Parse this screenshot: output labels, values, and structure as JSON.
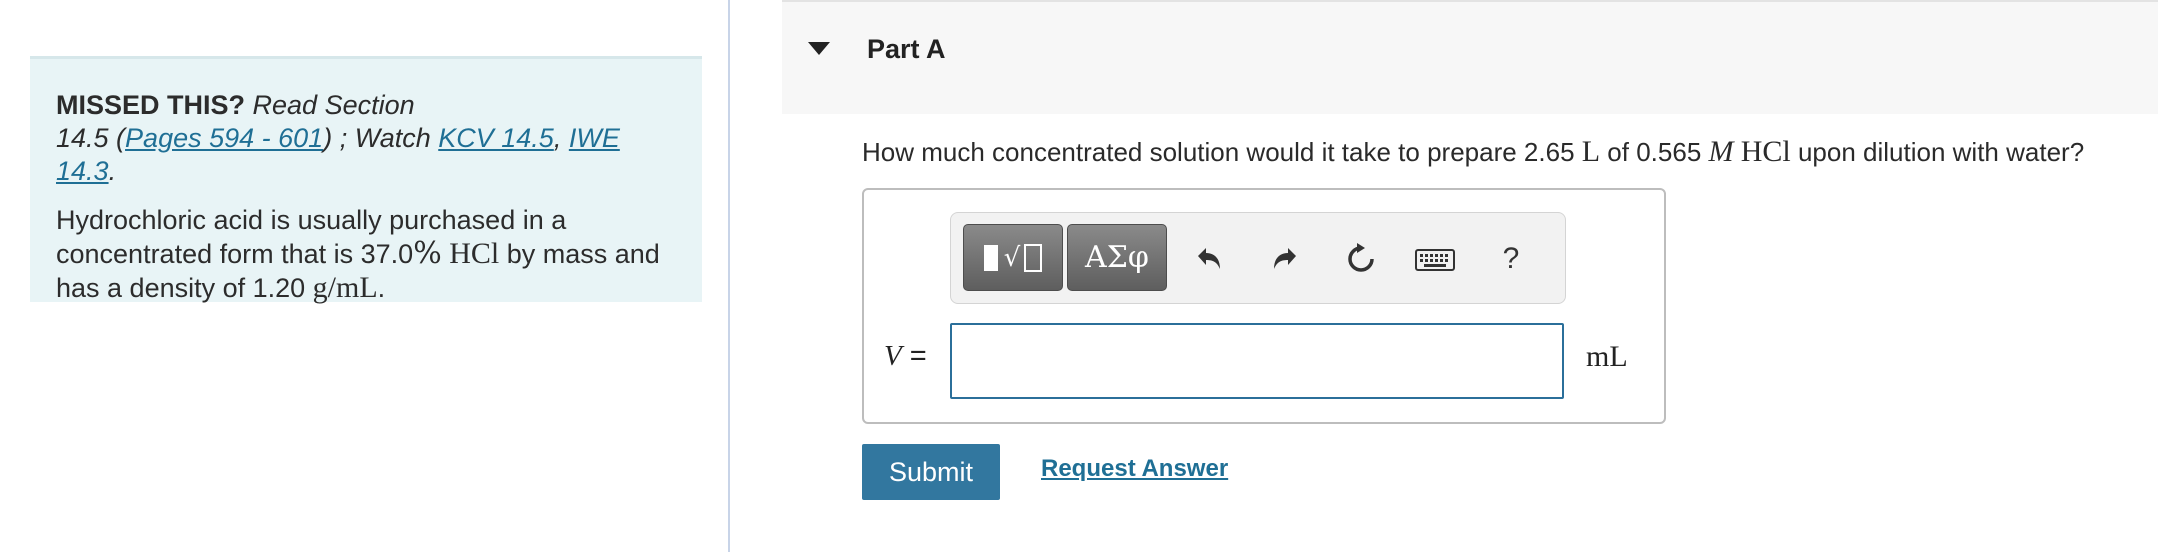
{
  "missed": {
    "title": "MISSED THIS?",
    "read_section": "Read Section",
    "section_number": "14.5 (",
    "pages_link": "Pages 594 - 601",
    "after_pages": ") ; Watch ",
    "kcv_link": "KCV 14.5",
    "comma": ", ",
    "iwe_link": "IWE 14.3",
    "period": ".",
    "para_text_1": "Hydrochloric acid is usually purchased in a concentrated form that is 37.0",
    "percent": "%",
    "hcl": "HCl",
    "para_text_2": " by mass and has a density of 1.20 ",
    "density_unit": "g/mL",
    "para_end": "."
  },
  "part": {
    "title": "Part A"
  },
  "question": {
    "text_1": "How much concentrated solution would it take to prepare 2.65 ",
    "unit_l": "L",
    "text_2": " of 0.565 ",
    "unit_m": "M",
    "species": "HCl",
    "text_3": " upon dilution with water?"
  },
  "answer": {
    "variable": "V",
    "equals": " =",
    "value": "",
    "unit": "mL"
  },
  "toolbar": {
    "templates_label": "√",
    "symbols_label": "ΑΣφ",
    "undo_icon": "undo-icon",
    "redo_icon": "redo-icon",
    "reset_icon": "reset-icon",
    "keyboard_icon": "keyboard-icon",
    "help_label": "?"
  },
  "actions": {
    "submit_label": "Submit",
    "request_answer_label": "Request Answer"
  },
  "colors": {
    "accent": "#32779f",
    "link": "#1f6f95",
    "hint_bg": "#e8f4f6"
  }
}
